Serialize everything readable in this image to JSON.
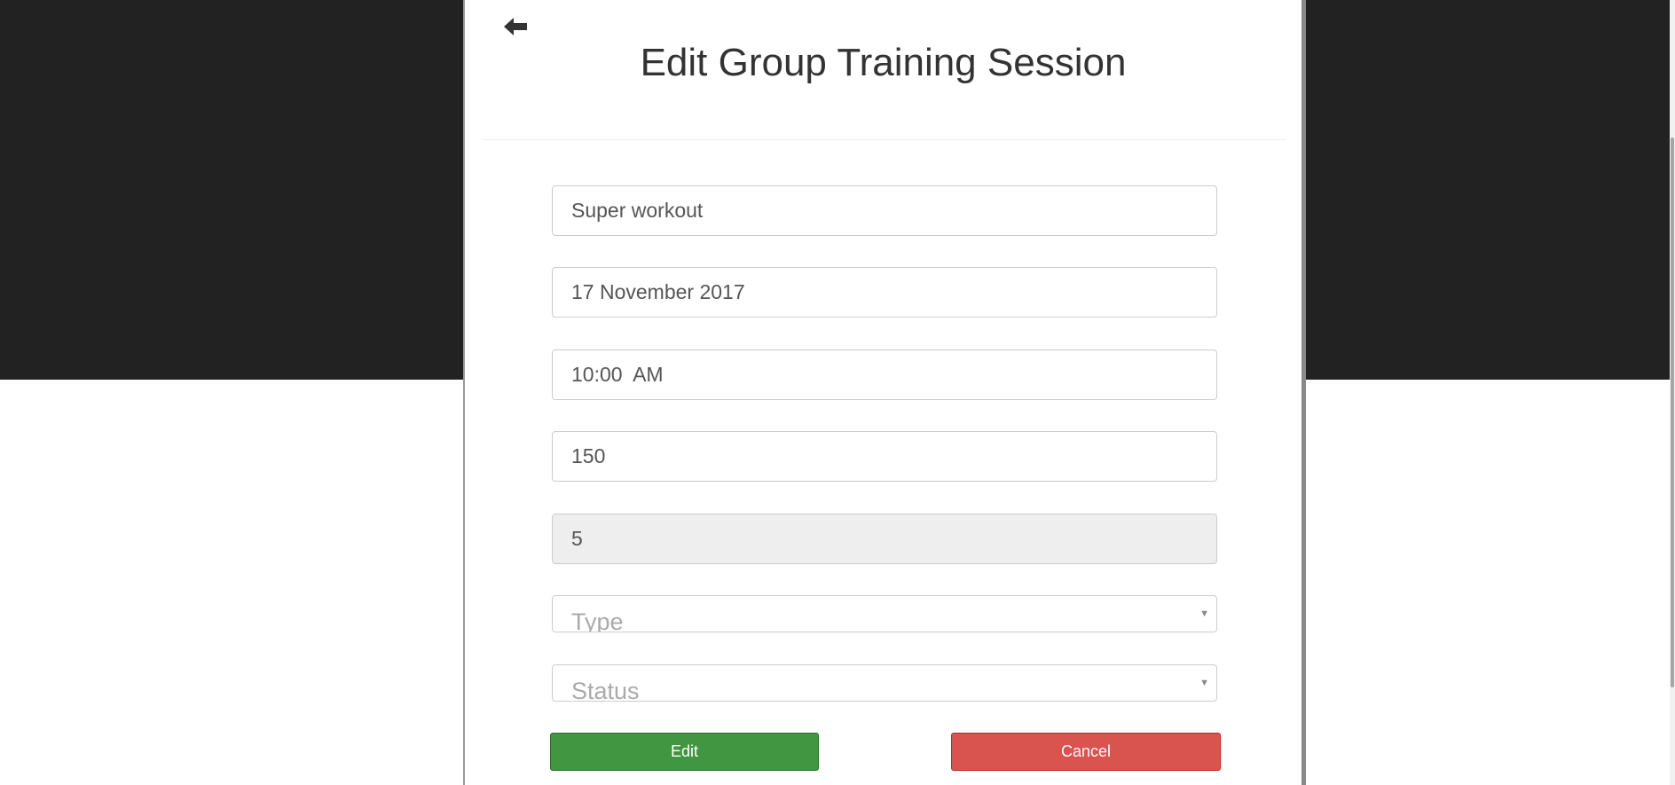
{
  "modal": {
    "title": "Edit Group Training Session",
    "back_icon": "arrow-left-icon"
  },
  "form": {
    "name": "Super workout",
    "date": "17 November 2017",
    "time": "10:00  AM",
    "duration": "150",
    "capacity": "5",
    "type_placeholder": "Type",
    "status_placeholder": "Status",
    "select_arrow": "▼"
  },
  "buttons": {
    "edit_label": "Edit",
    "cancel_label": "Cancel"
  },
  "colors": {
    "edit": "#419641",
    "cancel": "#d9534f",
    "backdrop": "#222222"
  }
}
